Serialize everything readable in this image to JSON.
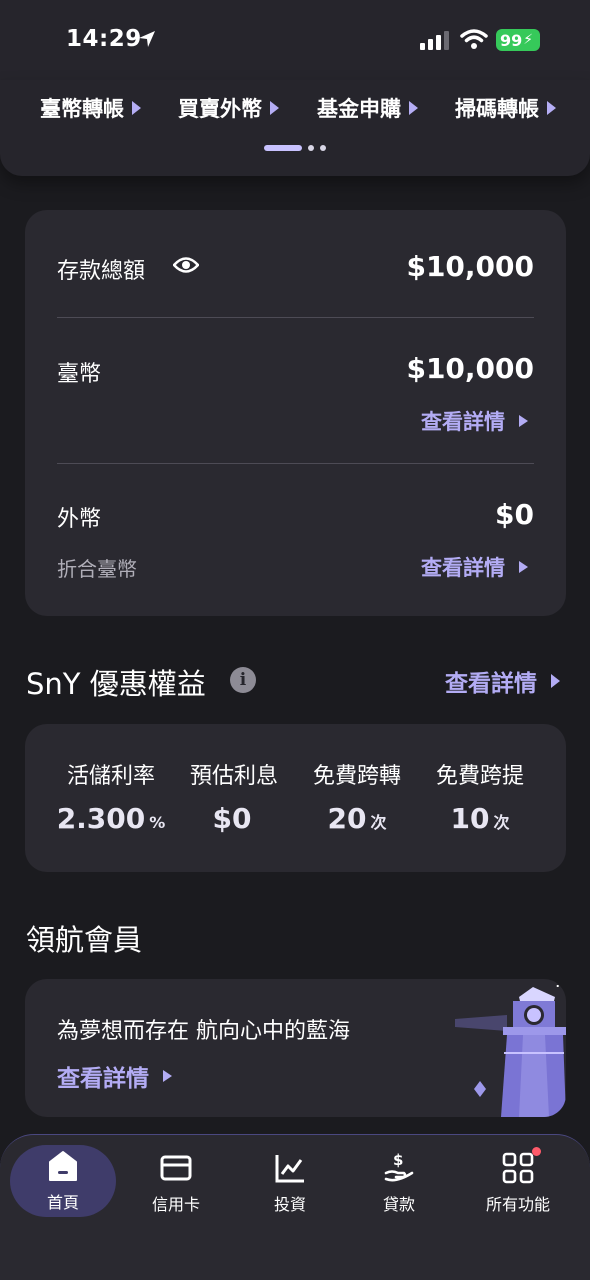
{
  "status_bar": {
    "time": "14:29",
    "battery": "99"
  },
  "quick_menu": {
    "items": [
      {
        "label": "臺幣轉帳"
      },
      {
        "label": "買賣外幣"
      },
      {
        "label": "基金申購"
      },
      {
        "label": "掃碼轉帳"
      }
    ]
  },
  "deposit": {
    "total_label": "存款總額",
    "total_amount": "$10,000",
    "twd_label": "臺幣",
    "twd_amount": "$10,000",
    "twd_detail": "查看詳情",
    "fx_label": "外幣",
    "fx_amount": "$0",
    "fx_sub_label": "折合臺幣",
    "fx_detail": "查看詳情"
  },
  "benefits_section": {
    "title": "SnY 優惠權益",
    "info_icon": "i",
    "link": "查看詳情",
    "items": [
      {
        "label": "活儲利率",
        "value": "2.300",
        "unit": "%"
      },
      {
        "label": "預估利息",
        "value": "$0",
        "unit": ""
      },
      {
        "label": "免費跨轉",
        "value": "20",
        "unit": "次"
      },
      {
        "label": "免費跨提",
        "value": "10",
        "unit": "次"
      }
    ]
  },
  "member_section": {
    "title": "領航會員",
    "text": "為夢想而存在 航向心中的藍海",
    "link": "查看詳情"
  },
  "bottom_nav": {
    "items": [
      {
        "label": "首頁",
        "icon": "home-icon"
      },
      {
        "label": "信用卡",
        "icon": "credit-card-icon"
      },
      {
        "label": "投資",
        "icon": "chart-icon"
      },
      {
        "label": "貸款",
        "icon": "loan-icon"
      },
      {
        "label": "所有功能",
        "icon": "grid-icon"
      }
    ]
  },
  "colors": {
    "background": "#1b1b1f",
    "card": "#2a2930",
    "accent": "#b3acf4",
    "home_pill": "#3f3c6a",
    "badge": "#ff5a6a",
    "battery": "#36c95a"
  }
}
